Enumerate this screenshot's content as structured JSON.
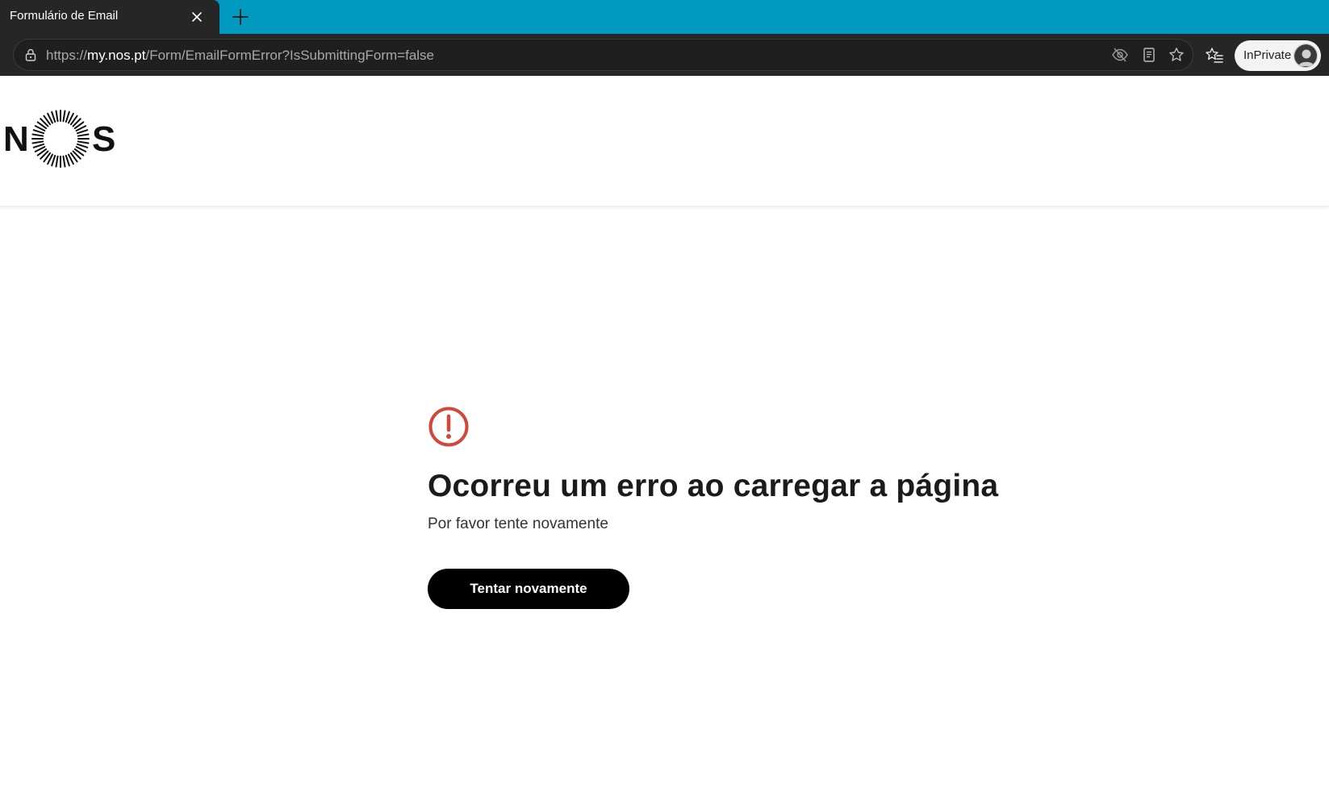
{
  "browser": {
    "tab": {
      "title": "Formulário de Email"
    },
    "url": {
      "scheme": "https://",
      "host": "my.nos.pt",
      "path": "/Form/EmailFormError?IsSubmittingForm=false"
    },
    "inprivate_label": "InPrivate",
    "icons": {
      "lock": "lock-icon",
      "tracking": "eye-off-icon",
      "reader": "reader-view-icon",
      "favorite": "star-icon",
      "favorites": "favorites-icon",
      "close_tab": "close-icon",
      "new_tab": "plus-icon"
    }
  },
  "header": {
    "logo": {
      "left": "N",
      "right": "S"
    }
  },
  "error": {
    "icon": "alert-circle-icon",
    "title": "Ocorreu um erro ao carregar a página",
    "subtitle": "Por favor tente novamente",
    "button_label": "Tentar novamente",
    "accent_color": "#d0483c"
  },
  "colors": {
    "tabstrip": "#0099bf",
    "chrome": "#262626",
    "button": "#000000"
  }
}
